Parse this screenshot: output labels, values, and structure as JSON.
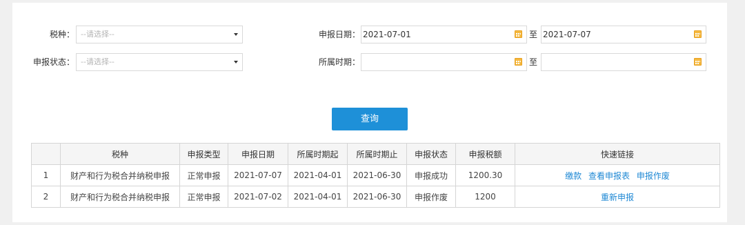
{
  "filters": {
    "tax_type_label": "税种：",
    "tax_type_placeholder": "--请选择--",
    "status_label": "申报状态：",
    "status_placeholder": "--请选择--",
    "declare_date_label": "申报日期：",
    "declare_date_from": "2021-07-01",
    "declare_date_to": "2021-07-07",
    "period_label": "所属时期：",
    "period_from": "",
    "period_to": "",
    "to_label": "至"
  },
  "query_button": "查询",
  "table": {
    "headers": [
      "",
      "税种",
      "申报类型",
      "申报日期",
      "所属时期起",
      "所属时期止",
      "申报状态",
      "申报税额",
      "快速链接"
    ],
    "rows": [
      {
        "index": "1",
        "tax": "财产和行为税合并纳税申报",
        "type": "正常申报",
        "date": "2021-07-07",
        "period_start": "2021-04-01",
        "period_end": "2021-06-30",
        "status": "申报成功",
        "amount": "1200.30",
        "links": [
          "缴款",
          "查看申报表",
          "申报作废"
        ]
      },
      {
        "index": "2",
        "tax": "财产和行为税合并纳税申报",
        "type": "正常申报",
        "date": "2021-07-02",
        "period_start": "2021-04-01",
        "period_end": "2021-06-30",
        "status": "申报作废",
        "amount": "1200",
        "links": [
          "重新申报"
        ]
      }
    ]
  },
  "colors": {
    "primary_button": "#1e90d8",
    "link": "#1e88d4",
    "calendar_icon": "#f5b940"
  }
}
